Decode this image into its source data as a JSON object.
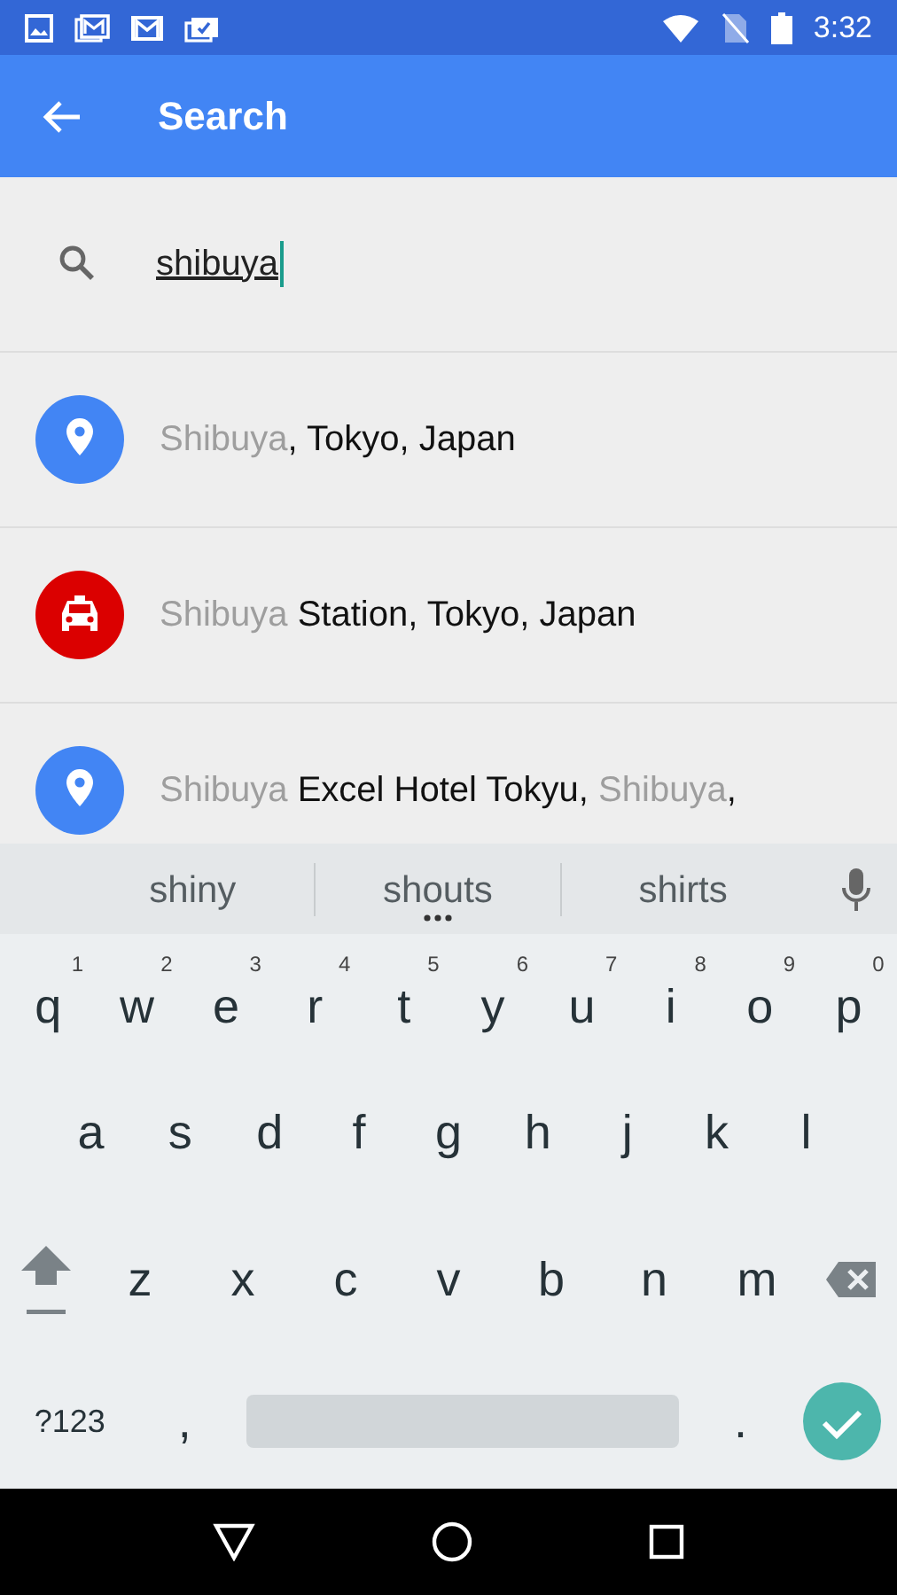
{
  "status_bar": {
    "time": "3:32"
  },
  "app_bar": {
    "title": "Search"
  },
  "search": {
    "value": "shibuya"
  },
  "results": [
    {
      "kind": "place",
      "color": "#4285f4",
      "parts": [
        {
          "text": "Shibuya",
          "match": true
        },
        {
          "text": ", Tokyo, Japan",
          "match": false
        }
      ]
    },
    {
      "kind": "taxi",
      "color": "#db0000",
      "parts": [
        {
          "text": "Shibuya",
          "match": true
        },
        {
          "text": " Station, Tokyo, Japan",
          "match": false
        }
      ]
    },
    {
      "kind": "place",
      "color": "#4285f4",
      "parts": [
        {
          "text": "Shibuya",
          "match": true
        },
        {
          "text": " Excel Hotel Tokyu, ",
          "match": false
        },
        {
          "text": "Shibuya",
          "match": true
        },
        {
          "text": ",",
          "match": false
        }
      ]
    }
  ],
  "suggestions": [
    {
      "text": "shiny",
      "selected": false
    },
    {
      "text": "shouts",
      "selected": true
    },
    {
      "text": "shirts",
      "selected": false
    }
  ],
  "keyboard": {
    "rows": [
      [
        {
          "kind": "letter",
          "label": "q",
          "hint": "1"
        },
        {
          "kind": "letter",
          "label": "w",
          "hint": "2"
        },
        {
          "kind": "letter",
          "label": "e",
          "hint": "3"
        },
        {
          "kind": "letter",
          "label": "r",
          "hint": "4"
        },
        {
          "kind": "letter",
          "label": "t",
          "hint": "5"
        },
        {
          "kind": "letter",
          "label": "y",
          "hint": "6"
        },
        {
          "kind": "letter",
          "label": "u",
          "hint": "7"
        },
        {
          "kind": "letter",
          "label": "i",
          "hint": "8"
        },
        {
          "kind": "letter",
          "label": "o",
          "hint": "9"
        },
        {
          "kind": "letter",
          "label": "p",
          "hint": "0"
        }
      ],
      [
        {
          "kind": "letter",
          "label": "a"
        },
        {
          "kind": "letter",
          "label": "s"
        },
        {
          "kind": "letter",
          "label": "d"
        },
        {
          "kind": "letter",
          "label": "f"
        },
        {
          "kind": "letter",
          "label": "g"
        },
        {
          "kind": "letter",
          "label": "h"
        },
        {
          "kind": "letter",
          "label": "j"
        },
        {
          "kind": "letter",
          "label": "k"
        },
        {
          "kind": "letter",
          "label": "l"
        }
      ],
      [
        {
          "kind": "shift"
        },
        {
          "kind": "letter",
          "label": "z"
        },
        {
          "kind": "letter",
          "label": "x"
        },
        {
          "kind": "letter",
          "label": "c"
        },
        {
          "kind": "letter",
          "label": "v"
        },
        {
          "kind": "letter",
          "label": "b"
        },
        {
          "kind": "letter",
          "label": "n"
        },
        {
          "kind": "letter",
          "label": "m"
        },
        {
          "kind": "delete"
        }
      ],
      [
        {
          "kind": "symbols",
          "label": "?123"
        },
        {
          "kind": "letter",
          "label": ","
        },
        {
          "kind": "space"
        },
        {
          "kind": "letter",
          "label": "."
        },
        {
          "kind": "enter"
        }
      ]
    ]
  }
}
